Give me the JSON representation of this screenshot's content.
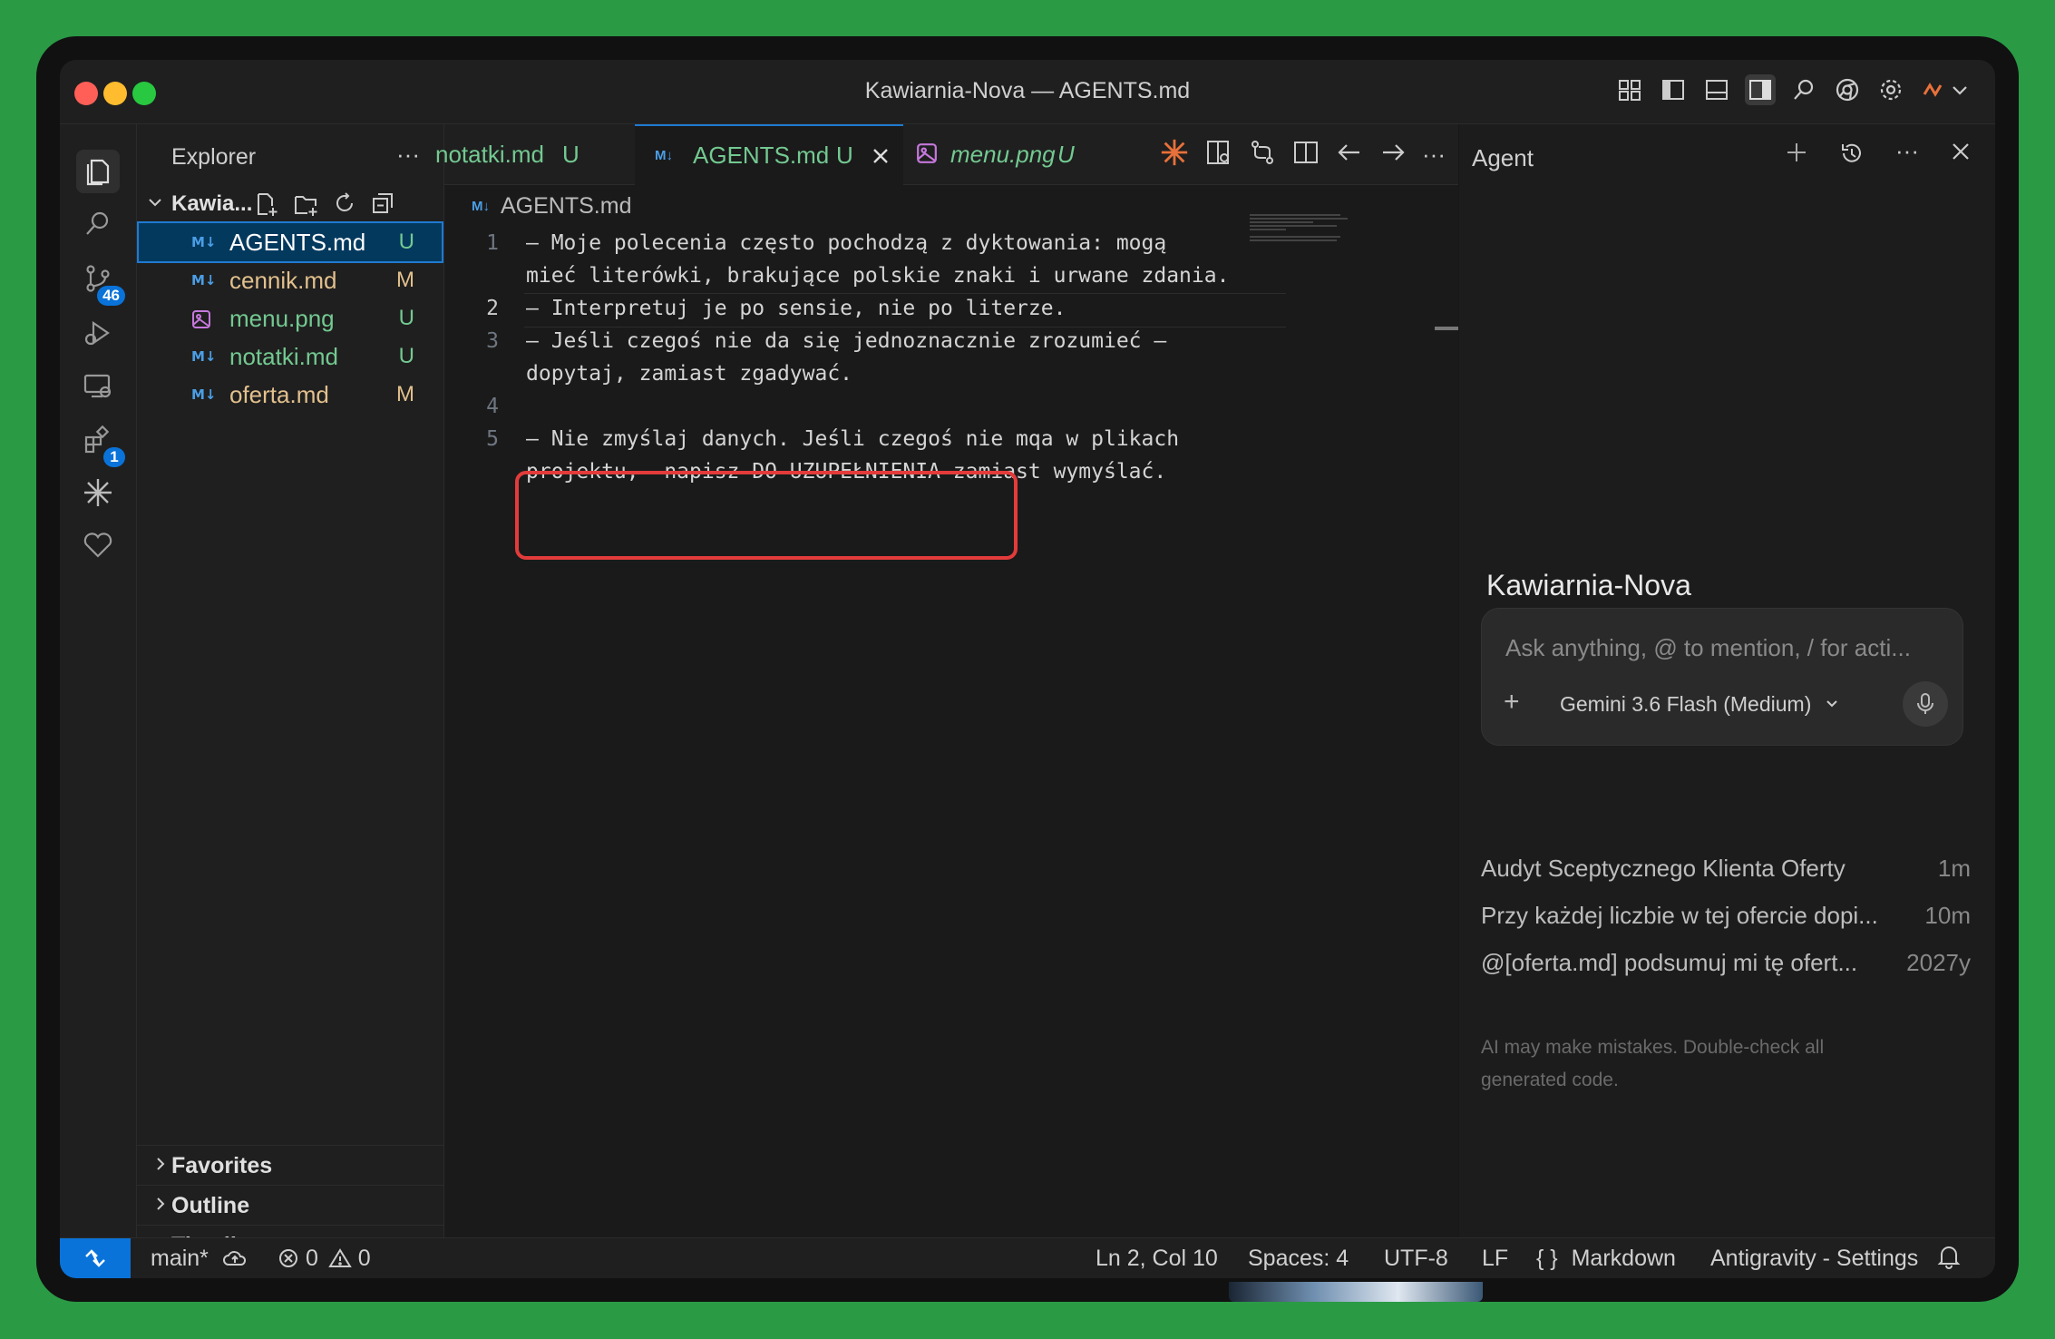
{
  "window": {
    "title": "Kawiarnia-Nova — AGENTS.md"
  },
  "titlebar_icons": [
    "layout-icon",
    "toggle-sidebar-icon",
    "toggle-panel-icon",
    "toggle-secondary-sidebar-icon",
    "search-icon",
    "chrome-icon",
    "gear-icon",
    "copilot-icon"
  ],
  "activity": {
    "scm_badge": "46",
    "extensions_badge": "1"
  },
  "explorer": {
    "title": "Explorer",
    "more": "···",
    "folder": "Kawia...",
    "files": [
      {
        "name": "AGENTS.md",
        "status": "U",
        "color": "#ffffff"
      },
      {
        "name": "cennik.md",
        "status": "M",
        "color": "#e2c08d"
      },
      {
        "name": "menu.png",
        "status": "U",
        "color": "#73c991"
      },
      {
        "name": "notatki.md",
        "status": "U",
        "color": "#73c991"
      },
      {
        "name": "oferta.md",
        "status": "M",
        "color": "#e2c08d"
      }
    ],
    "sections": [
      "Favorites",
      "Outline",
      "Timeline"
    ]
  },
  "tabs": [
    {
      "name": "notatki.md",
      "status": "U"
    },
    {
      "name": "AGENTS.md",
      "status": "U"
    },
    {
      "name": "menu.png",
      "status": "U"
    }
  ],
  "editor": {
    "breadcrumb": "AGENTS.md",
    "lines": [
      {
        "num": "1",
        "text": "– Moje polecenia często pochodzą z dyktowania: mogą"
      },
      {
        "num": "",
        "text": "mieć literówki, brakujące polskie znaki i urwane zdania."
      },
      {
        "num": "2",
        "text": "– Interpretuj je po sensie, nie po literze."
      },
      {
        "num": "3",
        "text": "– Jeśli czegoś nie da się jednoznacznie zrozumieć –"
      },
      {
        "num": "",
        "text": "dopytaj, zamiast zgadywać."
      },
      {
        "num": "4",
        "text": ""
      },
      {
        "num": "5",
        "text": "– Nie zmyślaj danych. Jeśli czegoś nie mqa w plikach"
      },
      {
        "num": "",
        "text": "projektu,  napisz DO UZUPEŁNIENIA zamiast wymyślać."
      }
    ]
  },
  "agent": {
    "title": "Agent",
    "workspace": "Kawiarnia-Nova",
    "placeholder": "Ask anything, @ to mention, / for acti...",
    "model": "Gemini 3.6 Flash (Medium)",
    "history": [
      {
        "title": "Audyt Sceptycznego Klienta Oferty",
        "time": "1m"
      },
      {
        "title": "Przy każdej liczbie w tej ofercie dopi...",
        "time": "10m"
      },
      {
        "title": "@[oferta.md] podsumuj mi tę ofert...",
        "time": "2027y"
      }
    ],
    "disclaimer": "AI may make mistakes. Double-check all generated code."
  },
  "status": {
    "branch": "main*",
    "errors": "0",
    "warnings": "0",
    "cursor": "Ln 2, Col 10",
    "spaces": "Spaces: 4",
    "encoding": "UTF-8",
    "eol": "LF",
    "language": "Markdown",
    "settings": "Antigravity - Settings"
  }
}
